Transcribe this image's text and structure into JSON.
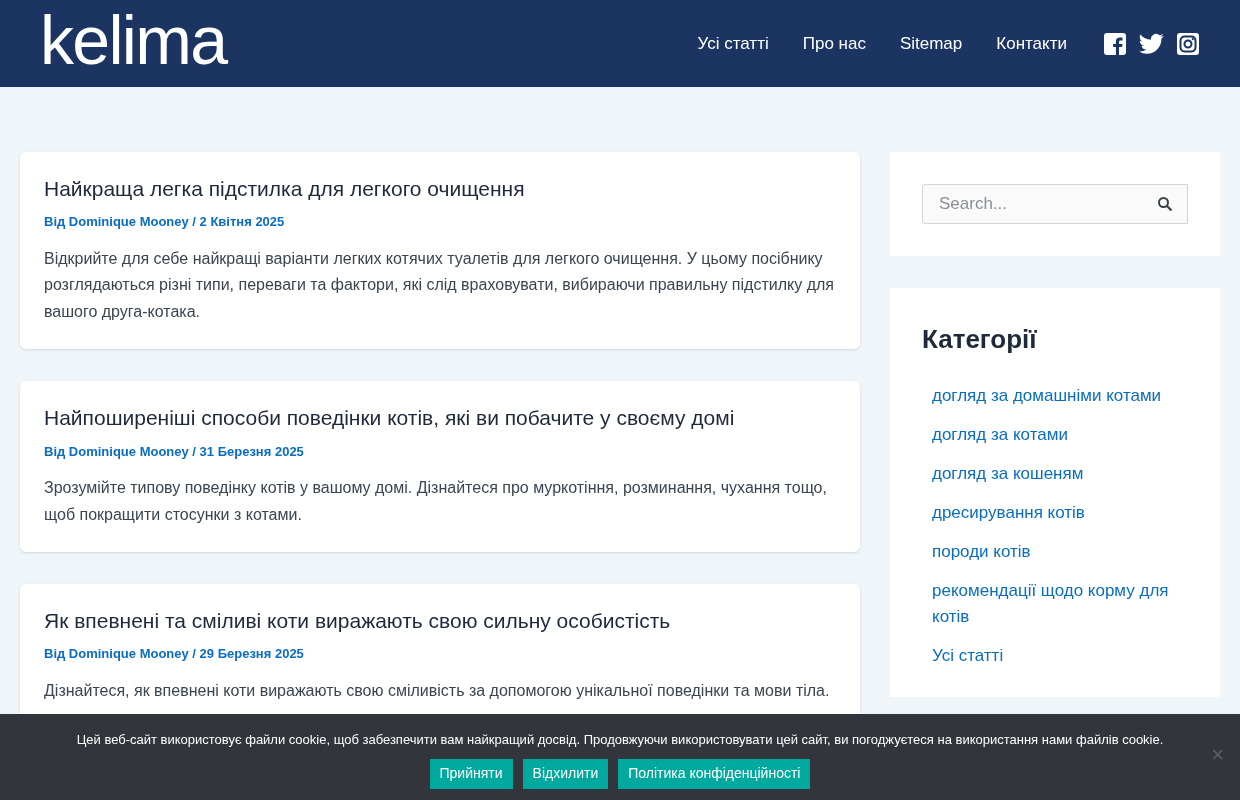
{
  "header": {
    "logo": "kelima",
    "nav": [
      "Усі статті",
      "Про нас",
      "Sitemap",
      "Контакти"
    ]
  },
  "posts": [
    {
      "title": "Найкраща легка підстилка для легкого очищення",
      "meta": "Від Dominique Mooney / 2 Квітня 2025",
      "excerpt": "Відкрийте для себе найкращі варіанти легких котячих туалетів для легкого очищення. У цьому посібнику розглядаються різні типи, переваги та фактори, які слід враховувати, вибираючи правильну підстилку для вашого друга-котака."
    },
    {
      "title": "Найпоширеніші способи поведінки котів, які ви побачите у своєму домі",
      "meta": "Від Dominique Mooney / 31 Березня 2025",
      "excerpt": "Зрозумійте типову поведінку котів у вашому домі. Дізнайтеся про муркотіння, розминання, чухання тощо, щоб покращити стосунки з котами."
    },
    {
      "title": "Як впевнені та сміливі коти виражають свою сильну особистість",
      "meta": "Від Dominique Mooney / 29 Березня 2025",
      "excerpt": "Дізнайтеся, як впевнені коти виражають свою сміливість за допомогою унікальної поведінки та мови тіла."
    }
  ],
  "sidebar": {
    "search": {
      "placeholder": "Search..."
    },
    "categories": {
      "title": "Категорії",
      "items": [
        "догляд за домашніми котами",
        "догляд за котами",
        "догляд за кошеням",
        "дресирування котів",
        "породи котів",
        "рекомендації щодо корму для котів",
        "Усі статті"
      ]
    }
  },
  "cookie_bar": {
    "message": "Цей веб-сайт використовує файли cookie, щоб забезпечити вам найкращий досвід. Продовжуючи використовувати цей сайт, ви погоджуєтеся на використання нами файлів cookie.",
    "buttons": [
      "Прийняти",
      "Відхилити",
      "Політика конфіденційності"
    ],
    "close": "×"
  }
}
